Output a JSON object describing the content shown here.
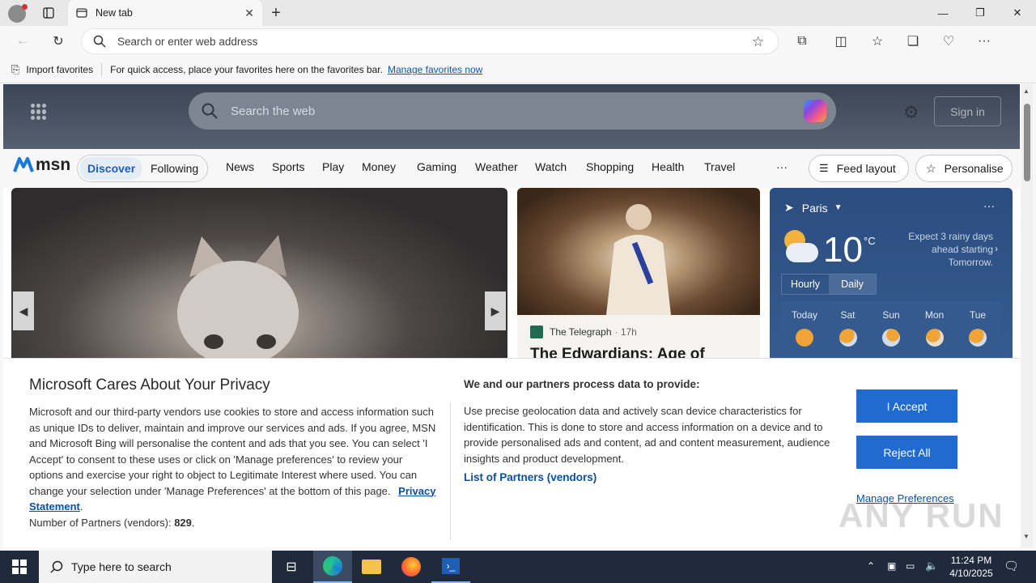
{
  "browser": {
    "tab_title": "New tab",
    "address_placeholder": "Search or enter web address"
  },
  "favorites_bar": {
    "import_label": "Import favorites",
    "hint": "For quick access, place your favorites here on the favorites bar.",
    "manage_link": "Manage favorites now"
  },
  "msn": {
    "logo": "msn",
    "search_placeholder": "Search the web",
    "sign_in": "Sign in",
    "tabs": [
      "Discover",
      "Following"
    ],
    "nav": [
      "News",
      "Sports",
      "Play",
      "Money",
      "Gaming",
      "Weather",
      "Watch",
      "Shopping",
      "Health",
      "Travel"
    ],
    "more": "···",
    "feed_layout": "Feed layout",
    "personalise": "Personalise"
  },
  "news_card": {
    "source": "The Telegraph",
    "age": "· 17h",
    "headline": "The Edwardians: Age of"
  },
  "weather": {
    "city": "Paris",
    "temp": "10",
    "unit": "°C",
    "summary": "Expect 3 rainy days ahead starting Tomorrow.",
    "toggle": [
      "Hourly",
      "Daily"
    ],
    "days": [
      "Today",
      "Sat",
      "Sun",
      "Mon",
      "Tue"
    ],
    "more": "···"
  },
  "consent": {
    "title": "Microsoft Cares About Your Privacy",
    "body": "Microsoft and our third-party vendors use cookies to store and access information such as unique IDs to deliver, maintain and improve our services and ads. If you agree, MSN and Microsoft Bing will personalise the content and ads that you see. You can select 'I Accept' to consent to these uses or click on 'Manage preferences' to review your options and exercise your right to object to Legitimate Interest where used.  You can change your selection under 'Manage Preferences' at the bottom of this page.",
    "privacy_link": "Privacy Statement",
    "partners_label": "Number of Partners (vendors):",
    "partners_count": "829",
    "right_title": "We and our partners process data to provide:",
    "right_body": "Use precise geolocation data and actively scan device characteristics for identification. This is done to store and access information on a device and to provide personalised ads and content, ad and content measurement, audience insights and product development.",
    "partners_link": "List of Partners (vendors)",
    "accept": "I Accept",
    "reject": "Reject All",
    "manage": "Manage Preferences"
  },
  "taskbar": {
    "search_placeholder": "Type here to search",
    "time": "11:24 PM",
    "date": "4/10/2025"
  },
  "watermark": "ANY RUN"
}
